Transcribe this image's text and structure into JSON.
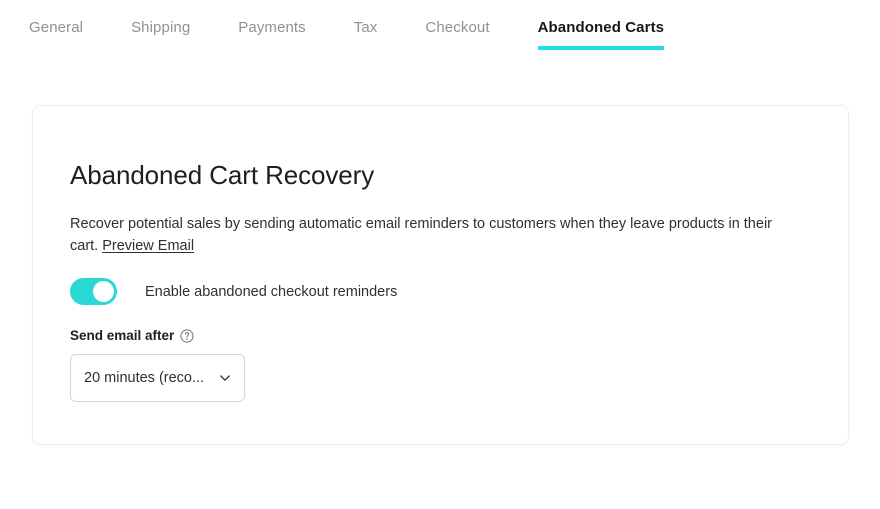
{
  "tabs": [
    {
      "label": "General",
      "active": false
    },
    {
      "label": "Shipping",
      "active": false
    },
    {
      "label": "Payments",
      "active": false
    },
    {
      "label": "Tax",
      "active": false
    },
    {
      "label": "Checkout",
      "active": false
    },
    {
      "label": "Abandoned Carts",
      "active": true
    }
  ],
  "card": {
    "title": "Abandoned Cart Recovery",
    "description": "Recover potential sales by sending automatic email reminders to customers when they leave products in their cart.",
    "preview_link": "Preview Email",
    "toggle": {
      "label": "Enable abandoned checkout reminders",
      "enabled": true
    },
    "delay_field": {
      "label": "Send email after",
      "help_icon": "question-circle-icon",
      "selected_value": "20 minutes (reco...",
      "chevron_icon": "chevron-down-icon"
    }
  },
  "colors": {
    "accent": "#1fdfde",
    "toggle_on": "#2ad9d6",
    "tab_inactive": "#8e9196",
    "tab_active": "#15181c",
    "text": "#2c3137",
    "card_border": "#ebedef",
    "input_border": "#d4d8dc"
  }
}
